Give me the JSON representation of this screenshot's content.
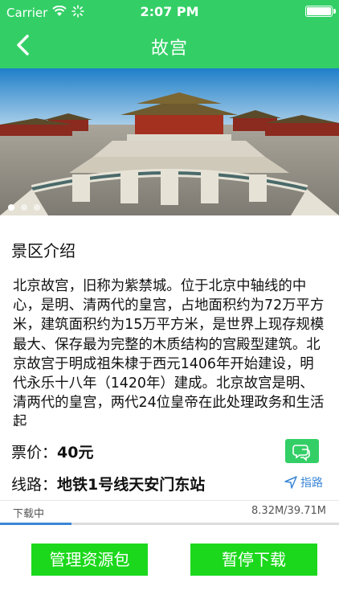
{
  "status_bar": {
    "carrier": "Carrier",
    "time": "2:07 PM"
  },
  "nav": {
    "title": "故宫"
  },
  "carousel": {
    "slide_count": 3,
    "active_index": 0
  },
  "intro": {
    "heading": "景区介绍",
    "text": "北京故宫，旧称为紫禁城。位于北京中轴线的中心，是明、清两代的皇宫，占地面积约为72万平方米，建筑面积约为15万平方米，是世界上现存规模最大、保存最为完整的木质结构的宫殿型建筑。北京故宫于明成祖朱棣于西元1406年开始建设，明代永乐十八年（1420年）建成。北京故宫是明、清两代的皇宫，两代24位皇帝在此处理政务和生活起"
  },
  "price": {
    "label": "票价：",
    "value": "40元"
  },
  "route": {
    "label": "线路：",
    "value": "地铁1号线天安门东站"
  },
  "navigate": {
    "label": "指路"
  },
  "download": {
    "status": "下载中",
    "size": "8.32M/39.71M",
    "progress": 0.21
  },
  "buttons": {
    "manage": "管理资源包",
    "pause": "暂停下载"
  },
  "colors": {
    "brand": "#33cf66",
    "button": "#1cd81c",
    "link": "#3a86d6"
  }
}
